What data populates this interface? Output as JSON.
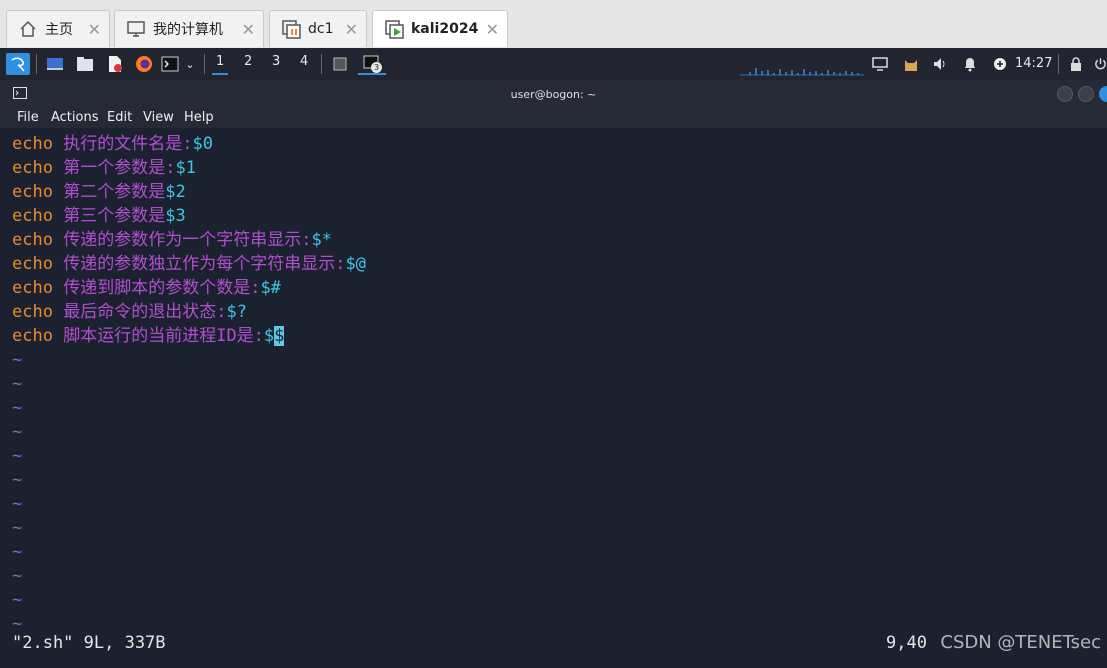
{
  "tabs": [
    {
      "label": "主页",
      "icon": "home-icon"
    },
    {
      "label": "我的计算机",
      "icon": "computer-icon"
    },
    {
      "label": "dc1",
      "icon": "vm-paused-icon"
    },
    {
      "label": "kali2024",
      "icon": "vm-running-icon"
    }
  ],
  "panel": {
    "workspaces": [
      "1",
      "2",
      "3",
      "4"
    ],
    "terminal_badge": "3",
    "clock": "14:27"
  },
  "window": {
    "title": "user@bogon: ~",
    "menu": [
      "File",
      "Actions",
      "Edit",
      "View",
      "Help"
    ]
  },
  "editor": {
    "lines": [
      {
        "cmd": "echo",
        "text": "执行的文件名是:",
        "var": "$0"
      },
      {
        "cmd": "echo",
        "text": "第一个参数是:",
        "var": "$1"
      },
      {
        "cmd": "echo",
        "text": "第二个参数是",
        "var": "$2"
      },
      {
        "cmd": "echo",
        "text": "第三个参数是",
        "var": "$3"
      },
      {
        "cmd": "echo",
        "text": "传递的参数作为一个字符串显示:",
        "var": "$*"
      },
      {
        "cmd": "echo",
        "text": "传递的参数独立作为每个字符串显示:",
        "var": "$@"
      },
      {
        "cmd": "echo",
        "text": "传递到脚本的参数个数是:",
        "var": "$#"
      },
      {
        "cmd": "echo",
        "text": "最后命令的退出状态:",
        "var": "$?"
      },
      {
        "cmd": "echo",
        "text": "脚本运行的当前进程ID是:",
        "var": "$",
        "cursor_char": "$"
      }
    ],
    "tilde": "~",
    "tilde_count": 12,
    "status_left": "\"2.sh\" 9L, 337B",
    "status_right": "9,40"
  },
  "watermark": "CSDN @TENETsec",
  "colors": {
    "keyword": "#e8892b",
    "string": "#b04fd0",
    "variable": "#3cc6e6",
    "tilde": "#4a82c9"
  }
}
